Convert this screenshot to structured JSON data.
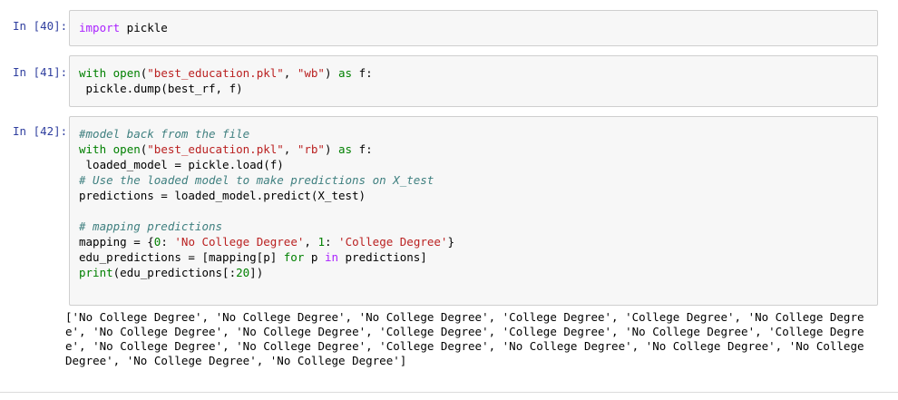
{
  "cells": [
    {
      "prompt": "In [40]:",
      "lines": [
        [
          {
            "t": "import",
            "c": "kw2"
          },
          {
            "t": " pickle",
            "c": "pl"
          }
        ]
      ]
    },
    {
      "prompt": "In [41]:",
      "lines": [
        [
          {
            "t": "with",
            "c": "kw"
          },
          {
            "t": " ",
            "c": "pl"
          },
          {
            "t": "open",
            "c": "fn"
          },
          {
            "t": "(",
            "c": "pl"
          },
          {
            "t": "\"best_education.pkl\"",
            "c": "str"
          },
          {
            "t": ", ",
            "c": "pl"
          },
          {
            "t": "\"wb\"",
            "c": "str"
          },
          {
            "t": ") ",
            "c": "pl"
          },
          {
            "t": "as",
            "c": "kw"
          },
          {
            "t": " f:",
            "c": "pl"
          }
        ],
        [
          {
            "t": " pickle.dump(best_rf, f)",
            "c": "pl"
          }
        ]
      ]
    },
    {
      "prompt": "In [42]:",
      "lines": [
        [
          {
            "t": "#model back from the file",
            "c": "cm"
          }
        ],
        [
          {
            "t": "with",
            "c": "kw"
          },
          {
            "t": " ",
            "c": "pl"
          },
          {
            "t": "open",
            "c": "fn"
          },
          {
            "t": "(",
            "c": "pl"
          },
          {
            "t": "\"best_education.pkl\"",
            "c": "str"
          },
          {
            "t": ", ",
            "c": "pl"
          },
          {
            "t": "\"rb\"",
            "c": "str"
          },
          {
            "t": ") ",
            "c": "pl"
          },
          {
            "t": "as",
            "c": "kw"
          },
          {
            "t": " f:",
            "c": "pl"
          }
        ],
        [
          {
            "t": " loaded_model = pickle.load(f)",
            "c": "pl"
          }
        ],
        [
          {
            "t": "# Use the loaded model to make predictions on X_test",
            "c": "cm"
          }
        ],
        [
          {
            "t": "predictions = loaded_model.predict(X_test)",
            "c": "pl"
          }
        ],
        [
          {
            "t": "",
            "c": "pl"
          }
        ],
        [
          {
            "t": "# mapping predictions",
            "c": "cm"
          }
        ],
        [
          {
            "t": "mapping = {",
            "c": "pl"
          },
          {
            "t": "0",
            "c": "num"
          },
          {
            "t": ": ",
            "c": "pl"
          },
          {
            "t": "'No College Degree'",
            "c": "str"
          },
          {
            "t": ", ",
            "c": "pl"
          },
          {
            "t": "1",
            "c": "num"
          },
          {
            "t": ": ",
            "c": "pl"
          },
          {
            "t": "'College Degree'",
            "c": "str"
          },
          {
            "t": "}",
            "c": "pl"
          }
        ],
        [
          {
            "t": "edu_predictions = [mapping[p] ",
            "c": "pl"
          },
          {
            "t": "for",
            "c": "kw"
          },
          {
            "t": " p ",
            "c": "pl"
          },
          {
            "t": "in",
            "c": "kw2"
          },
          {
            "t": " predictions]",
            "c": "pl"
          }
        ],
        [
          {
            "t": "print",
            "c": "fn"
          },
          {
            "t": "(edu_predictions[:",
            "c": "pl"
          },
          {
            "t": "20",
            "c": "num"
          },
          {
            "t": "])",
            "c": "pl"
          }
        ]
      ],
      "output": "['No College Degree', 'No College Degree', 'No College Degree', 'College Degree', 'College Degree', 'No College Degree', 'No College Degree', 'No College Degree', 'College Degree', 'College Degree', 'No College Degree', 'College Degree', 'No College Degree', 'No College Degree', 'College Degree', 'No College Degree', 'No College Degree', 'No College Degree', 'No College Degree', 'No College Degree']"
    }
  ]
}
